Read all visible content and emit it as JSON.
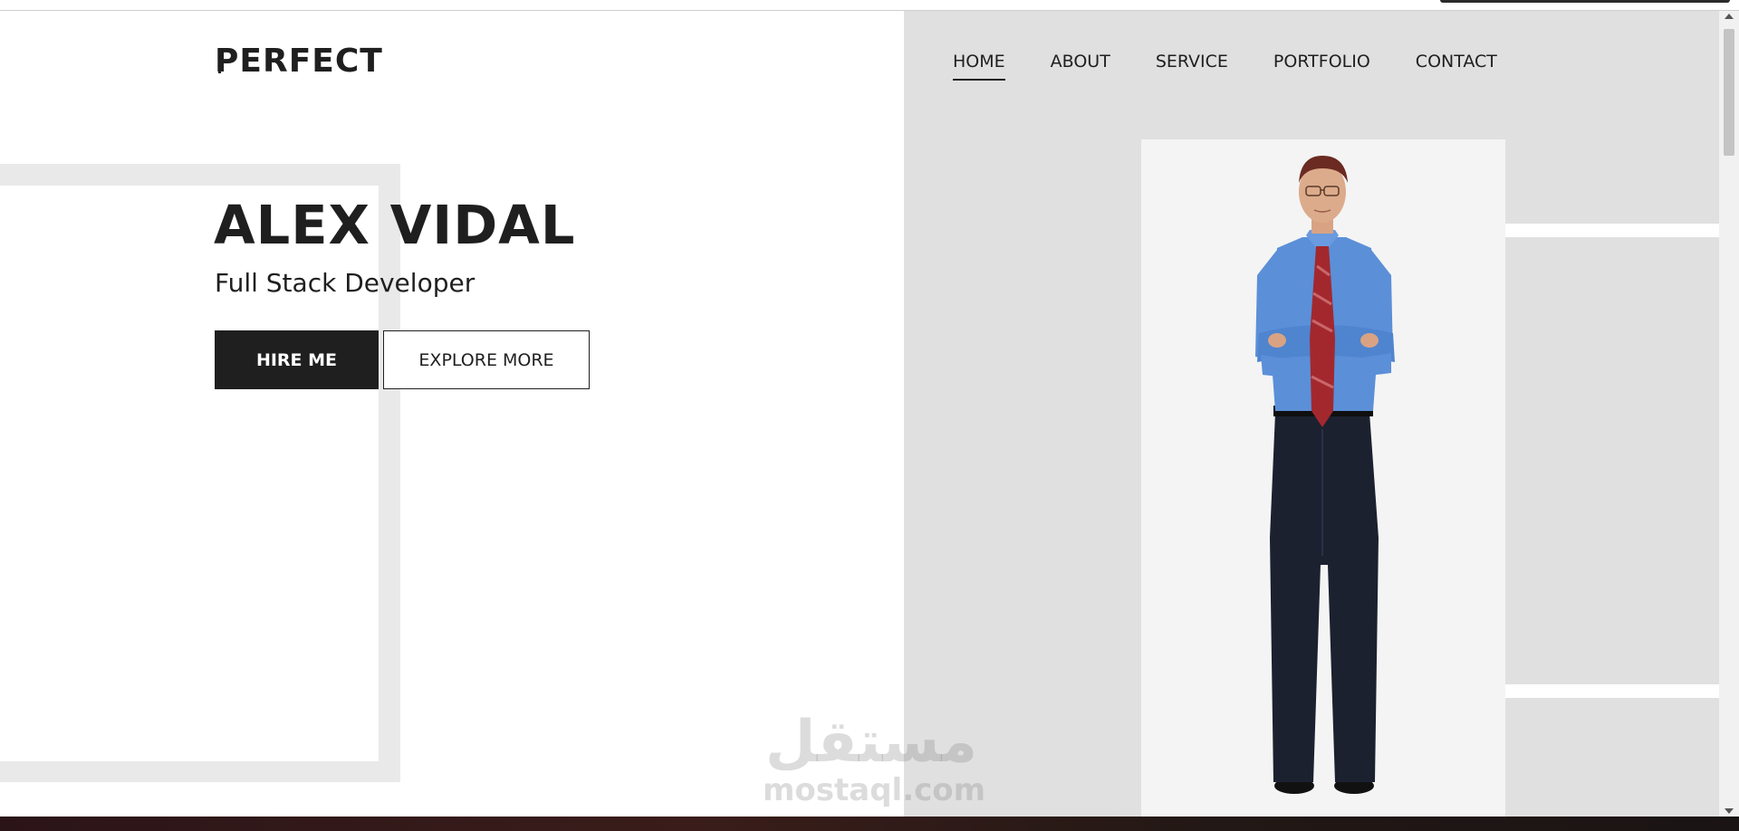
{
  "header": {
    "logo": "PERFECT",
    "nav": [
      {
        "label": "HOME",
        "active": true
      },
      {
        "label": "ABOUT",
        "active": false
      },
      {
        "label": "SERVICE",
        "active": false
      },
      {
        "label": "PORTFOLIO",
        "active": false
      },
      {
        "label": "CONTACT",
        "active": false
      }
    ]
  },
  "hero": {
    "name": "ALEX VIDAL",
    "role": "Full Stack Developer",
    "primary_button": "HIRE ME",
    "secondary_button": "EXPLORE MORE"
  },
  "watermark": {
    "arabic": "مستقل",
    "latin": "mostaql.com"
  },
  "colors": {
    "dark": "#1f1f1f",
    "panel_gray": "#e0e0e0",
    "card_gray": "#f4f4f4",
    "shirt_blue": "#5b8fd8",
    "tie_red": "#a3282e",
    "trousers": "#1c2130"
  }
}
